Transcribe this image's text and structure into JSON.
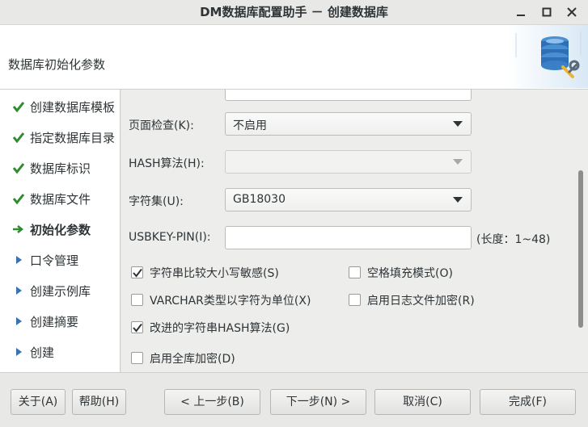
{
  "window": {
    "title": "DM数据库配置助手 － 创建数据库"
  },
  "header": {
    "heading": "数据库初始化参数",
    "logo_icon": "database-settings-icon"
  },
  "sidebar": {
    "items": [
      {
        "label": "创建数据库模板",
        "state": "done"
      },
      {
        "label": "指定数据库目录",
        "state": "done"
      },
      {
        "label": "数据库标识",
        "state": "done"
      },
      {
        "label": "数据库文件",
        "state": "done"
      },
      {
        "label": "初始化参数",
        "state": "current"
      },
      {
        "label": "口令管理",
        "state": "pending"
      },
      {
        "label": "创建示例库",
        "state": "pending"
      },
      {
        "label": "创建摘要",
        "state": "pending"
      },
      {
        "label": "创建",
        "state": "pending"
      }
    ]
  },
  "form": {
    "page_check": {
      "label": "页面检查(K):",
      "value": "不启用"
    },
    "hash_algo": {
      "label": "HASH算法(H):",
      "value": ""
    },
    "charset": {
      "label": "字符集(U):",
      "value": "GB18030"
    },
    "usbkey": {
      "label": "USBKEY-PIN(I):",
      "value": "",
      "hint": "(长度：1~48)"
    },
    "options": {
      "case_sensitive": {
        "label": "字符串比较大小写敏感(S)",
        "checked": true
      },
      "blank_pad": {
        "label": "空格填充模式(O)",
        "checked": false
      },
      "varchar_char_unit": {
        "label": "VARCHAR类型以字符为单位(X)",
        "checked": false
      },
      "log_encrypt": {
        "label": "启用日志文件加密(R)",
        "checked": false
      },
      "improved_hash": {
        "label": "改进的字符串HASH算法(G)",
        "checked": true
      },
      "full_db_encrypt": {
        "label": "启用全库加密(D)",
        "checked": false
      }
    }
  },
  "footer": {
    "about": "关于(A)",
    "help": "帮助(H)",
    "prev": "< 上一步(B)",
    "next": "下一步(N) >",
    "cancel": "取消(C)",
    "finish": "完成(F)"
  },
  "colors": {
    "check_green": "#2e8b2e",
    "arrow_green": "#2e8b2e",
    "pending_blue": "#3a73b4"
  }
}
